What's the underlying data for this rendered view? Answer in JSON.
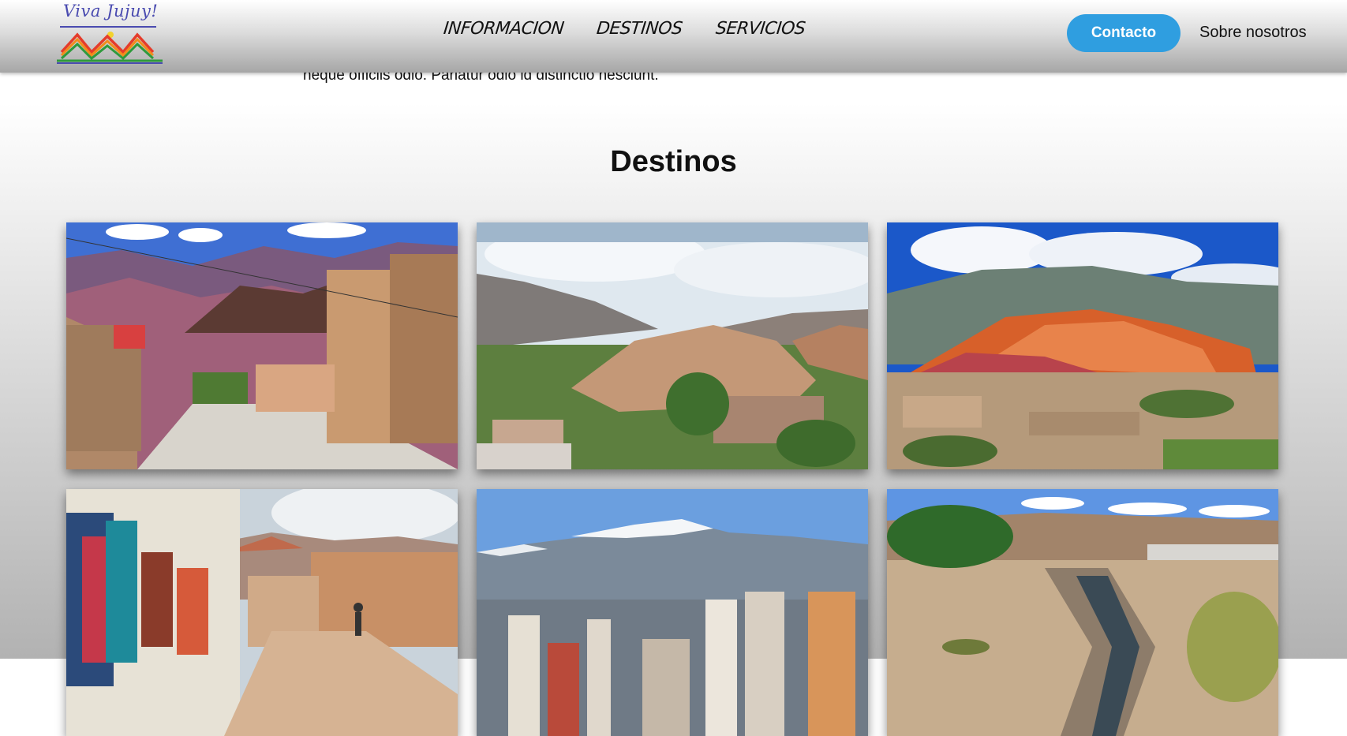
{
  "header": {
    "logo_text": "Viva Jujuy!",
    "nav": [
      {
        "label": "INFORMACION"
      },
      {
        "label": "DESTINOS"
      },
      {
        "label": "SERVICIOS"
      }
    ],
    "contact_label": "Contacto",
    "about_label": "Sobre nosotros"
  },
  "intro": {
    "text": "neque officiis odio. Pariatur odio id distinctio nesciunt."
  },
  "destinos": {
    "title": "Destinos",
    "cards": [
      {
        "name": "street-mountains-photo"
      },
      {
        "name": "valley-town-photo"
      },
      {
        "name": "seven-colors-hill-photo"
      },
      {
        "name": "artisan-market-street-photo"
      },
      {
        "name": "city-snowy-mountain-photo"
      },
      {
        "name": "dry-river-photo"
      }
    ]
  },
  "colors": {
    "accent": "#2f9ee0",
    "logo": "#4a4bb0"
  }
}
